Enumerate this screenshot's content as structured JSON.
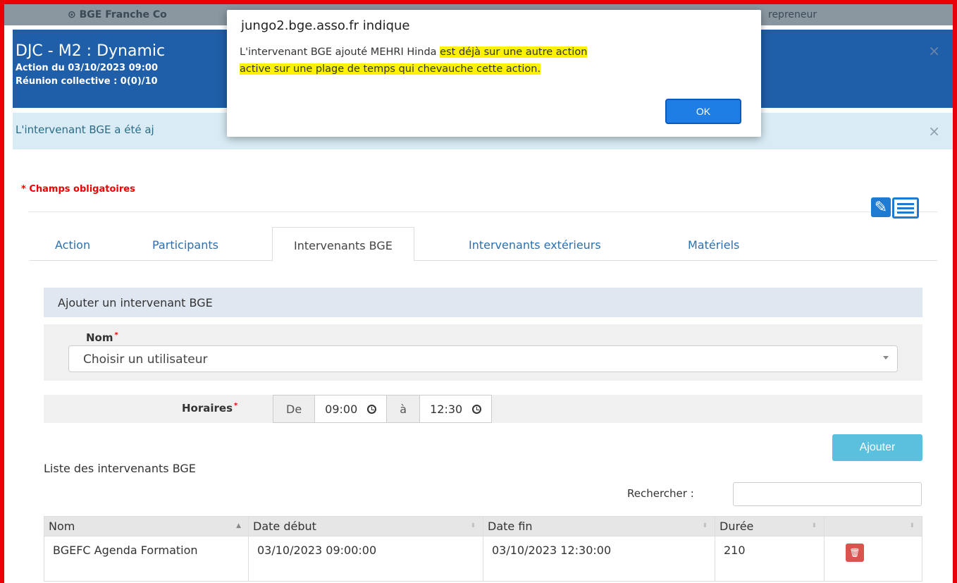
{
  "background": {
    "top_bar_left": "⊙ BGE Franche Co",
    "top_bar_right": "repreneur",
    "header": {
      "title": "DJC - M2 : Dynamic",
      "line1": "Action du 03/10/2023 09:00",
      "line2": "Réunion collective : 0(0)/10",
      "close": "×"
    },
    "notice": {
      "text": "L'intervenant BGE a été aj",
      "close": "×"
    }
  },
  "form": {
    "required_note": "* Champs obligatoires",
    "tabs": [
      {
        "label": "Action"
      },
      {
        "label": "Participants"
      },
      {
        "label": "Intervenants BGE",
        "active": true
      },
      {
        "label": "Intervenants extérieurs"
      },
      {
        "label": "Matériels"
      }
    ],
    "section_title": "Ajouter un intervenant BGE",
    "nom_label": "Nom",
    "nom_value": "Choisir un utilisateur",
    "horaires_label": "Horaires",
    "de_label": "De",
    "de_time": "09:00",
    "a_label": "à",
    "a_time": "12:30",
    "add_button": "Ajouter",
    "required_star": "*"
  },
  "list": {
    "title": "Liste des intervenants BGE",
    "search_label": "Rechercher :",
    "columns": [
      "Nom",
      "Date début",
      "Date fin",
      "Durée",
      ""
    ],
    "rows": [
      {
        "nom": "BGEFC Agenda Formation",
        "debut": "03/10/2023 09:00:00",
        "fin": "03/10/2023 12:30:00",
        "duree": "210"
      }
    ]
  },
  "dialog": {
    "title": "jungo2.bge.asso.fr indique",
    "message_plain": "L'intervenant BGE ajouté MEHRI Hinda ",
    "message_highlight_1": "est déjà sur une autre action",
    "message_highlight_2": "active sur une plage de temps qui chevauche cette action.",
    "ok_label": "OK"
  },
  "colors": {
    "frame": "#e8000b",
    "header": "#1f5ea8",
    "highlight": "#fff200",
    "ok_button": "#1e7ee6"
  },
  "icons": [
    "edit-icon",
    "list-view-icon",
    "clock-icon",
    "trash-icon",
    "close-icon",
    "sort-icon"
  ]
}
